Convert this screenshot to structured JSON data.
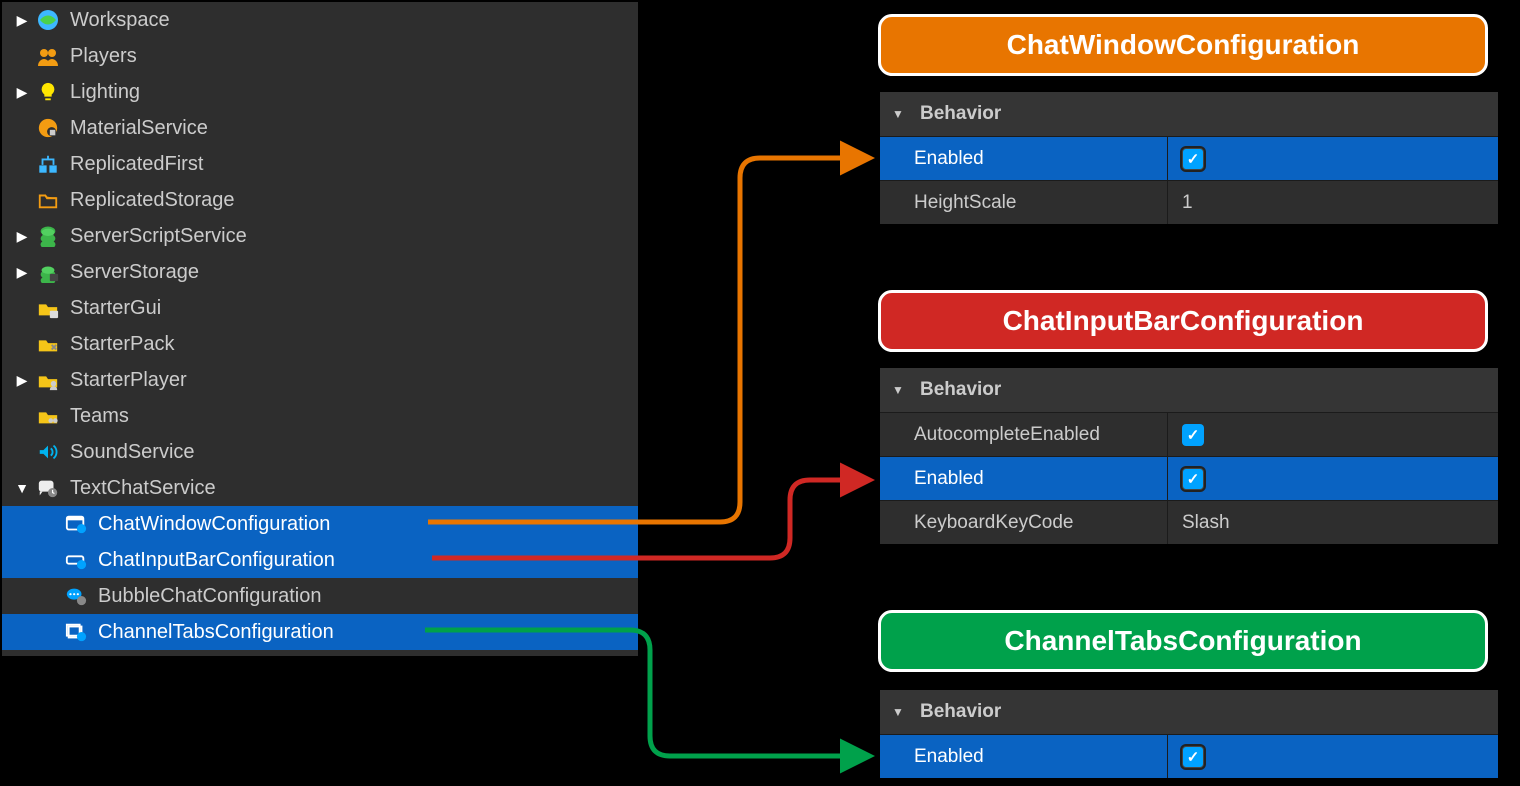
{
  "explorer": {
    "items": [
      {
        "label": "Workspace",
        "expandable": true,
        "indent": 0
      },
      {
        "label": "Players",
        "expandable": false,
        "indent": 0
      },
      {
        "label": "Lighting",
        "expandable": true,
        "indent": 0
      },
      {
        "label": "MaterialService",
        "expandable": false,
        "indent": 0
      },
      {
        "label": "ReplicatedFirst",
        "expandable": false,
        "indent": 0
      },
      {
        "label": "ReplicatedStorage",
        "expandable": false,
        "indent": 0
      },
      {
        "label": "ServerScriptService",
        "expandable": true,
        "indent": 0
      },
      {
        "label": "ServerStorage",
        "expandable": true,
        "indent": 0
      },
      {
        "label": "StarterGui",
        "expandable": false,
        "indent": 0
      },
      {
        "label": "StarterPack",
        "expandable": false,
        "indent": 0
      },
      {
        "label": "StarterPlayer",
        "expandable": true,
        "indent": 0
      },
      {
        "label": "Teams",
        "expandable": false,
        "indent": 0
      },
      {
        "label": "SoundService",
        "expandable": false,
        "indent": 0
      },
      {
        "label": "TextChatService",
        "expandable": true,
        "expanded": true,
        "indent": 0
      }
    ],
    "children": [
      {
        "label": "ChatWindowConfiguration",
        "selected": true
      },
      {
        "label": "ChatInputBarConfiguration",
        "selected": true
      },
      {
        "label": "BubbleChatConfiguration",
        "selected": false
      },
      {
        "label": "ChannelTabsConfiguration",
        "selected": true
      }
    ]
  },
  "callouts": {
    "window": "ChatWindowConfiguration",
    "input": "ChatInputBarConfiguration",
    "tabs": "ChannelTabsConfiguration"
  },
  "panels": {
    "behavior_label": "Behavior",
    "window": {
      "rows": [
        {
          "key": "Enabled",
          "type": "check",
          "hl": true
        },
        {
          "key": "HeightScale",
          "val": "1",
          "type": "text",
          "hl": false
        }
      ]
    },
    "input": {
      "rows": [
        {
          "key": "AutocompleteEnabled",
          "type": "check",
          "hl": false
        },
        {
          "key": "Enabled",
          "type": "check",
          "hl": true
        },
        {
          "key": "KeyboardKeyCode",
          "val": "Slash",
          "type": "text",
          "hl": false
        }
      ]
    },
    "tabs": {
      "rows": [
        {
          "key": "Enabled",
          "type": "check",
          "hl": true
        }
      ]
    }
  },
  "colors": {
    "orange": "#e87500",
    "red": "#d02824",
    "green": "#00a14b"
  }
}
